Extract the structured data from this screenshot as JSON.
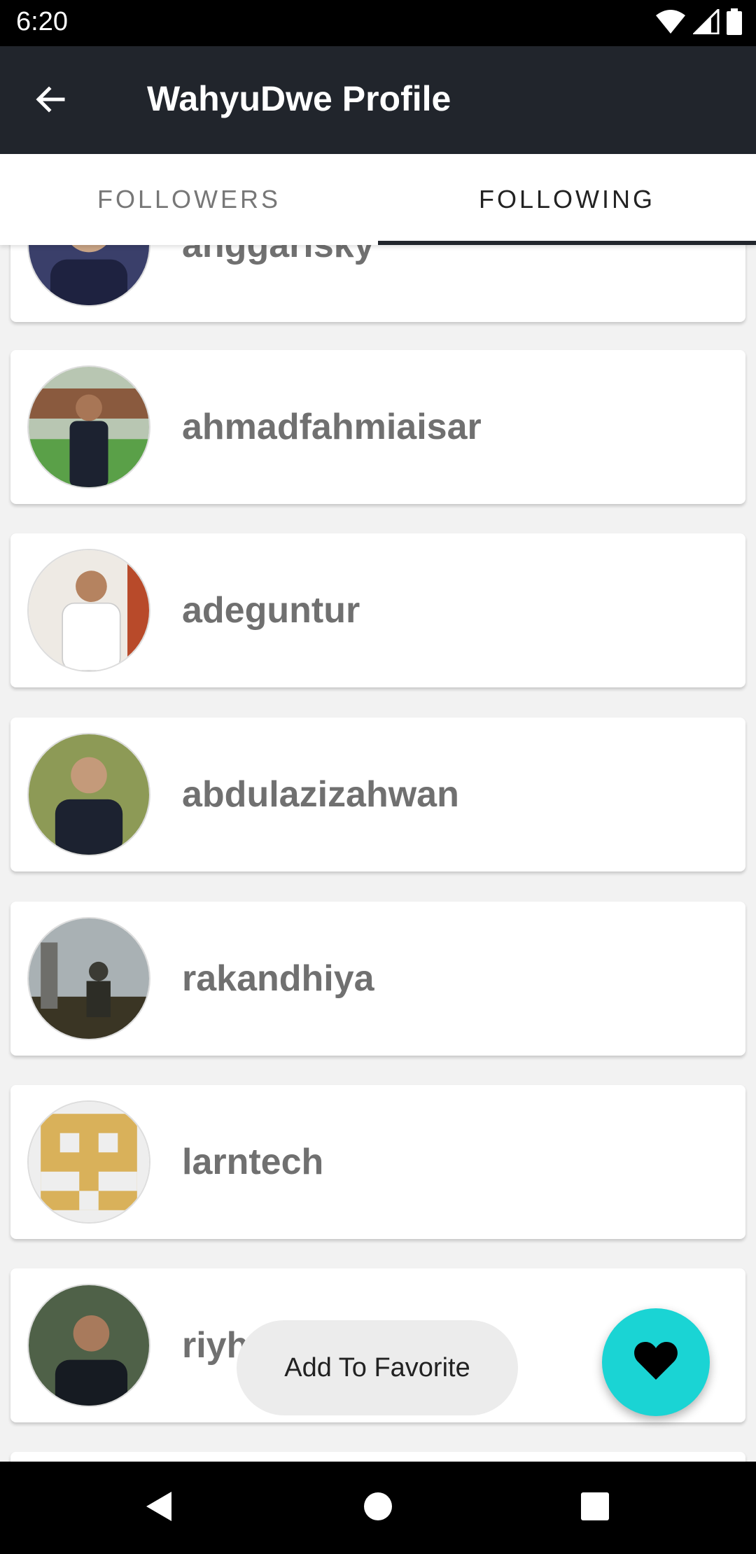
{
  "status_bar": {
    "time": "6:20",
    "icons": [
      "wifi-icon",
      "signal-icon",
      "battery-icon"
    ]
  },
  "app_bar": {
    "title": "WahyuDwe Profile",
    "back_icon": "arrow-back-icon"
  },
  "tabs": [
    {
      "label": "FOLLOWERS",
      "selected": false
    },
    {
      "label": "FOLLOWING",
      "selected": true
    }
  ],
  "following": [
    {
      "username": "anggarisky"
    },
    {
      "username": "ahmadfahmiaisar"
    },
    {
      "username": "adeguntur"
    },
    {
      "username": "abdulazizahwan"
    },
    {
      "username": "rakandhiya"
    },
    {
      "username": "larntech"
    },
    {
      "username": "riyhs"
    }
  ],
  "snackbar": {
    "text": "Add To Favorite"
  },
  "fab": {
    "icon": "heart-icon",
    "color": "#1ad4d4"
  },
  "nav_bar": {
    "icons": [
      "back-triangle-icon",
      "home-circle-icon",
      "recents-square-icon"
    ]
  },
  "colors": {
    "app_bar": "#21252c",
    "status_bar": "#000000",
    "username": "#707070",
    "accent": "#1ad4d4"
  }
}
